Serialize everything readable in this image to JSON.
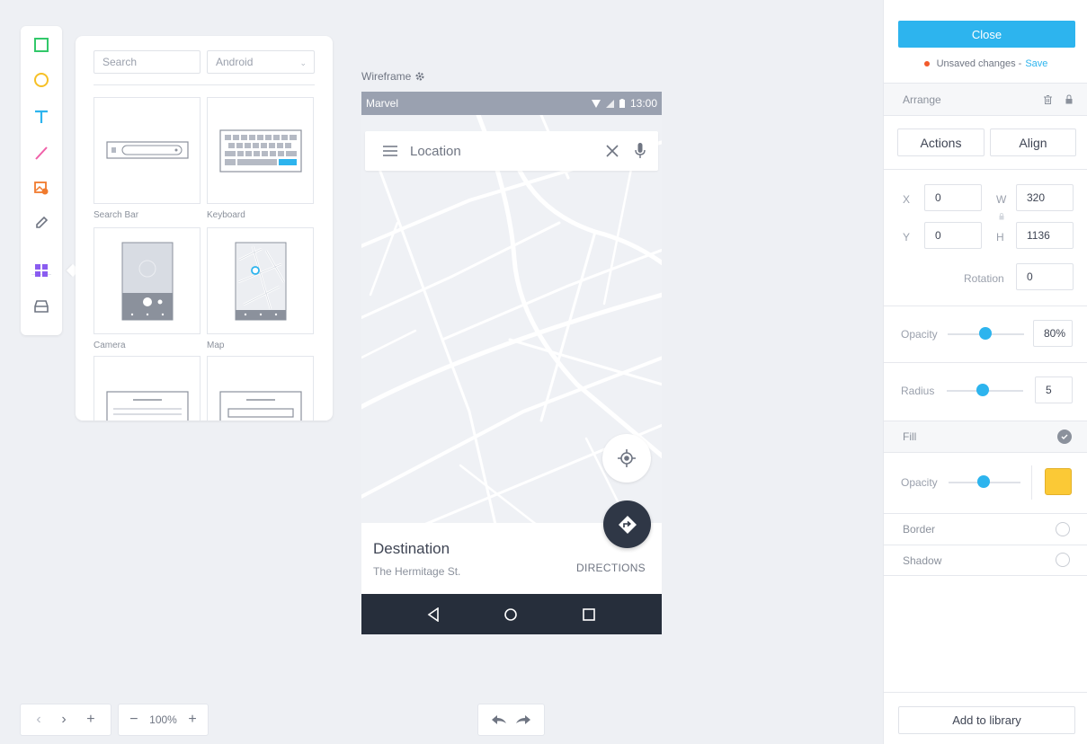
{
  "toolbar": {
    "tools": [
      {
        "icon": "rectangle-icon",
        "color": "#32c86a"
      },
      {
        "icon": "ellipse-icon",
        "color": "#f6c026"
      },
      {
        "icon": "text-icon",
        "color": "#2db4ee"
      },
      {
        "icon": "line-icon",
        "color": "#f05fa8"
      },
      {
        "icon": "image-icon",
        "color": "#f07a2e"
      },
      {
        "icon": "pencil-icon",
        "color": "#6f7582"
      },
      {
        "icon": "components-icon",
        "color": "#8a5cf0"
      },
      {
        "icon": "library-icon",
        "color": "#6f7582"
      }
    ]
  },
  "library": {
    "search_placeholder": "Search",
    "platform": "Android",
    "items": [
      {
        "label": "Search Bar"
      },
      {
        "label": "Keyboard"
      },
      {
        "label": "Camera"
      },
      {
        "label": "Map"
      },
      {
        "label": ""
      },
      {
        "label": ""
      }
    ]
  },
  "wireframe": {
    "label": "Wireframe",
    "status_app": "Marvel",
    "status_time": "13:00",
    "search_text": "Location",
    "destination_title": "Destination",
    "destination_subtitle": "The Hermitage St.",
    "directions_label": "DIRECTIONS"
  },
  "bottom": {
    "zoom_minus": "−",
    "zoom_level": "100%",
    "zoom_plus": "+",
    "nav_prev": "‹",
    "nav_next": "›",
    "nav_add": "+"
  },
  "panel": {
    "close_label": "Close",
    "unsaved_label": "Unsaved changes -",
    "save_label": "Save",
    "arrange_label": "Arrange",
    "actions_label": "Actions",
    "align_label": "Align",
    "x_label": "X",
    "x_value": "0",
    "y_label": "Y",
    "y_value": "0",
    "w_label": "W",
    "w_value": "320",
    "h_label": "H",
    "h_value": "1136",
    "rotation_label": "Rotation",
    "rotation_value": "0",
    "opacity_label": "Opacity",
    "opacity_value": "80%",
    "radius_label": "Radius",
    "radius_value": "5",
    "fill_label": "Fill",
    "fill_opacity_label": "Opacity",
    "fill_color": "#fbc936",
    "border_label": "Border",
    "shadow_label": "Shadow",
    "add_library_label": "Add to library"
  }
}
